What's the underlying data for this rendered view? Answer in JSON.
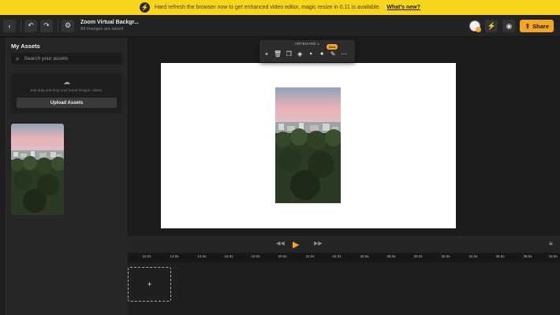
{
  "banner": {
    "message": "Hard refresh the browser now to get enhanced video editor, magic resize in 0.11 is available.",
    "link": "What's new?",
    "icon": "bolt-icon"
  },
  "header": {
    "doc_title": "Zoom Virtual Backgr...",
    "doc_status": "All changes are saved",
    "share_label": "Share",
    "icons": [
      "back-icon",
      "undo-icon",
      "redo-icon",
      "settings-icon",
      "avatar",
      "bolt-icon",
      "eye-icon"
    ]
  },
  "assets": {
    "title": "My Assets",
    "search_placeholder": "Search your assets",
    "drop_hint": "Just drag and drop your brand images, videos.",
    "upload_label": "Upload Assets"
  },
  "toolbar": {
    "board_label": "ARTBOARD 1",
    "new_badge": "New",
    "tools": [
      "add-icon",
      "delete-icon",
      "duplicate-icon",
      "fill-icon",
      "chevron-down-icon",
      "magic-icon",
      "edit-icon",
      "more-icon"
    ]
  },
  "timeline": {
    "ticks": [
      "10.0s",
      "12.0s",
      "14.0s",
      "16.0s",
      "18.0s",
      "20.0s",
      "22.0s",
      "24.0s",
      "26.0s",
      "28.0s",
      "30.0s",
      "32.0s",
      "34.0s",
      "36.0s",
      "38.0s",
      "40.0s"
    ],
    "add_label": "+"
  },
  "colors": {
    "accent": "#f5a623",
    "banner_bg": "#f7d51d",
    "canvas_bg": "#1c1c1c",
    "artboard_bg": "#ffffff"
  }
}
